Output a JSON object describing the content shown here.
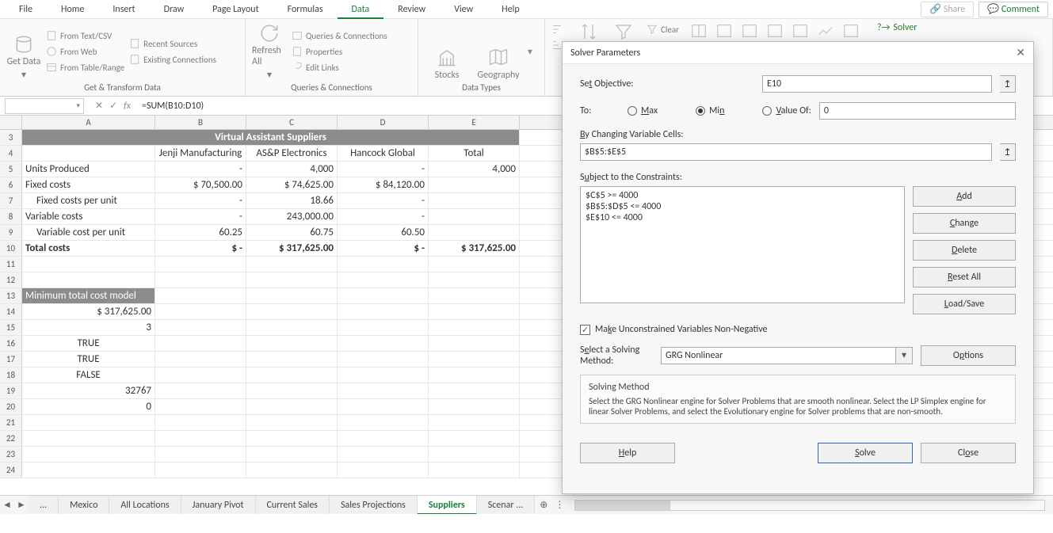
{
  "menu": {
    "tabs": [
      "File",
      "Home",
      "Insert",
      "Draw",
      "Page Layout",
      "Formulas",
      "Data",
      "Review",
      "View",
      "Help"
    ],
    "active": 6,
    "share": "Share",
    "comment": "Comment"
  },
  "ribbon": {
    "get_data": "Get Data",
    "from_textcsv": "From Text/CSV",
    "from_web": "From Web",
    "from_table": "From Table/Range",
    "recent": "Recent Sources",
    "existing": "Existing Connections",
    "group_get": "Get & Transform Data",
    "refresh": "Refresh All",
    "queries": "Queries & Connections",
    "properties": "Properties",
    "edit_links": "Edit Links",
    "group_conn": "Queries & Connections",
    "stocks": "Stocks",
    "geography": "Geography",
    "group_types": "Data Types",
    "clear": "Clear",
    "solver": "Solver"
  },
  "formula": {
    "name": "",
    "cancel": "✕",
    "enter": "✓",
    "fx_label": "fx",
    "value": "=SUM(B10:D10)"
  },
  "cols": [
    "A",
    "B",
    "C",
    "D",
    "E"
  ],
  "rows_start": 3,
  "grid": {
    "title": "Virtual Assistant Suppliers",
    "h": {
      "b": "Jenji Manufacturing",
      "c": "AS&P Electronics",
      "d": "Hancock Global",
      "e": "Total"
    },
    "r5": {
      "a": "Units Produced",
      "b": "-",
      "c": "4,000",
      "d": "-",
      "e": "4,000"
    },
    "r6": {
      "a": "Fixed costs",
      "b": "$        70,500.00",
      "c": "$        74,625.00",
      "d": "$        84,120.00",
      "e": ""
    },
    "r7": {
      "a": "Fixed costs per unit",
      "b": "-",
      "c": "18.66",
      "d": "-",
      "e": ""
    },
    "r8": {
      "a": "Variable costs",
      "b": "-",
      "c": "243,000.00",
      "d": "-",
      "e": ""
    },
    "r9": {
      "a": "Variable cost per unit",
      "b": "60.25",
      "c": "60.75",
      "d": "60.50",
      "e": ""
    },
    "r10": {
      "a": "Total costs",
      "b": "$                   -",
      "c": "$ 317,625.00",
      "d": "$                   -",
      "e": "$  317,625.00"
    },
    "r13": "Minimum total cost model",
    "r14": "$          317,625.00",
    "r15": "3",
    "r16": "TRUE",
    "r17": "TRUE",
    "r18": "FALSE",
    "r19": "32767",
    "r20": "0"
  },
  "sheets": {
    "items": [
      "...",
      "Mexico",
      "All Locations",
      "January Pivot",
      "Current Sales",
      "Sales Projections",
      "Suppliers",
      "Scenar ..."
    ],
    "active": 6
  },
  "solver": {
    "title": "Solver Parameters",
    "set_obj": "Set Objective:",
    "obj_val": "E10",
    "to": "To:",
    "max": "Max",
    "min": "Min",
    "valueof": "Value Of:",
    "valueof_val": "0",
    "by_changing": "By Changing Variable Cells:",
    "changing_val": "$B$5:$E$5",
    "subject": "Subject to the Constraints:",
    "constraints": [
      "$C$5 >= 4000",
      "$B$5:$D$5 <= 4000",
      "$E$10 <= 4000"
    ],
    "add": "Add",
    "change": "Change",
    "delete": "Delete",
    "reset": "Reset All",
    "loadsave": "Load/Save",
    "uncon": "Make Unconstrained Variables Non-Negative",
    "sel_method": "Select a Solving Method:",
    "method": "GRG Nonlinear",
    "options": "Options",
    "method_h": "Solving Method",
    "method_t": "Select the GRG Nonlinear engine for Solver Problems that are smooth nonlinear. Select the LP Simplex engine for linear Solver Problems, and select the Evolutionary engine for Solver problems that are non-smooth.",
    "help": "Help",
    "solve": "Solve",
    "close": "Close"
  }
}
